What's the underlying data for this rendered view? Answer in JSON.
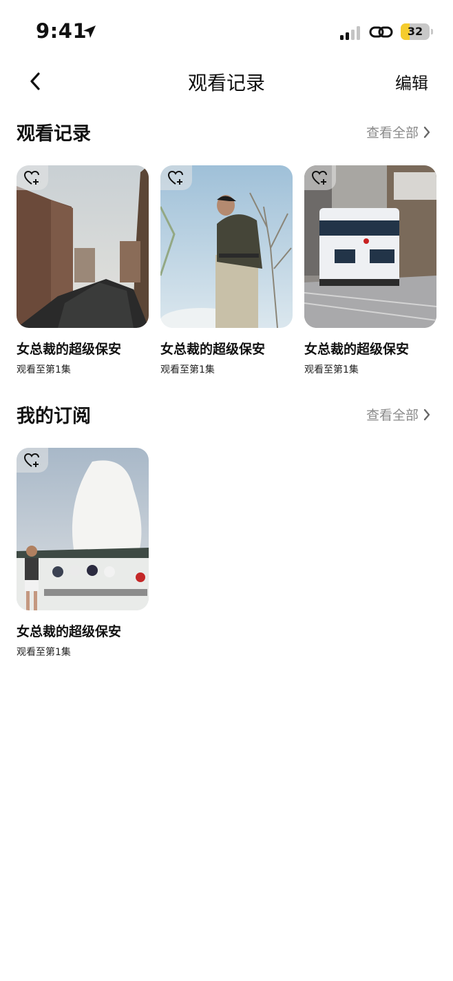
{
  "status_bar": {
    "time": "9:41",
    "battery_percent": "32"
  },
  "nav": {
    "title": "观看记录",
    "edit_label": "编辑"
  },
  "watch_history": {
    "title": "观看记录",
    "view_all": "查看全部",
    "items": [
      {
        "title": "女总裁的超级保安",
        "progress": "观看至第1集"
      },
      {
        "title": "女总裁的超级保安",
        "progress": "观看至第1集"
      },
      {
        "title": "女总裁的超级保安",
        "progress": "观看至第1集"
      }
    ]
  },
  "subscriptions": {
    "title": "我的订阅",
    "view_all": "查看全部",
    "items": [
      {
        "title": "女总裁的超级保安",
        "progress": "观看至第1集"
      }
    ]
  },
  "colors": {
    "battery_fill": "#f5cc2d",
    "secondary_text": "#8a8a8a"
  },
  "icons": [
    "location-arrow-icon",
    "signal-icon",
    "link-icon",
    "battery-icon",
    "back-chevron-icon",
    "chevron-right-icon",
    "heart-plus-icon"
  ]
}
